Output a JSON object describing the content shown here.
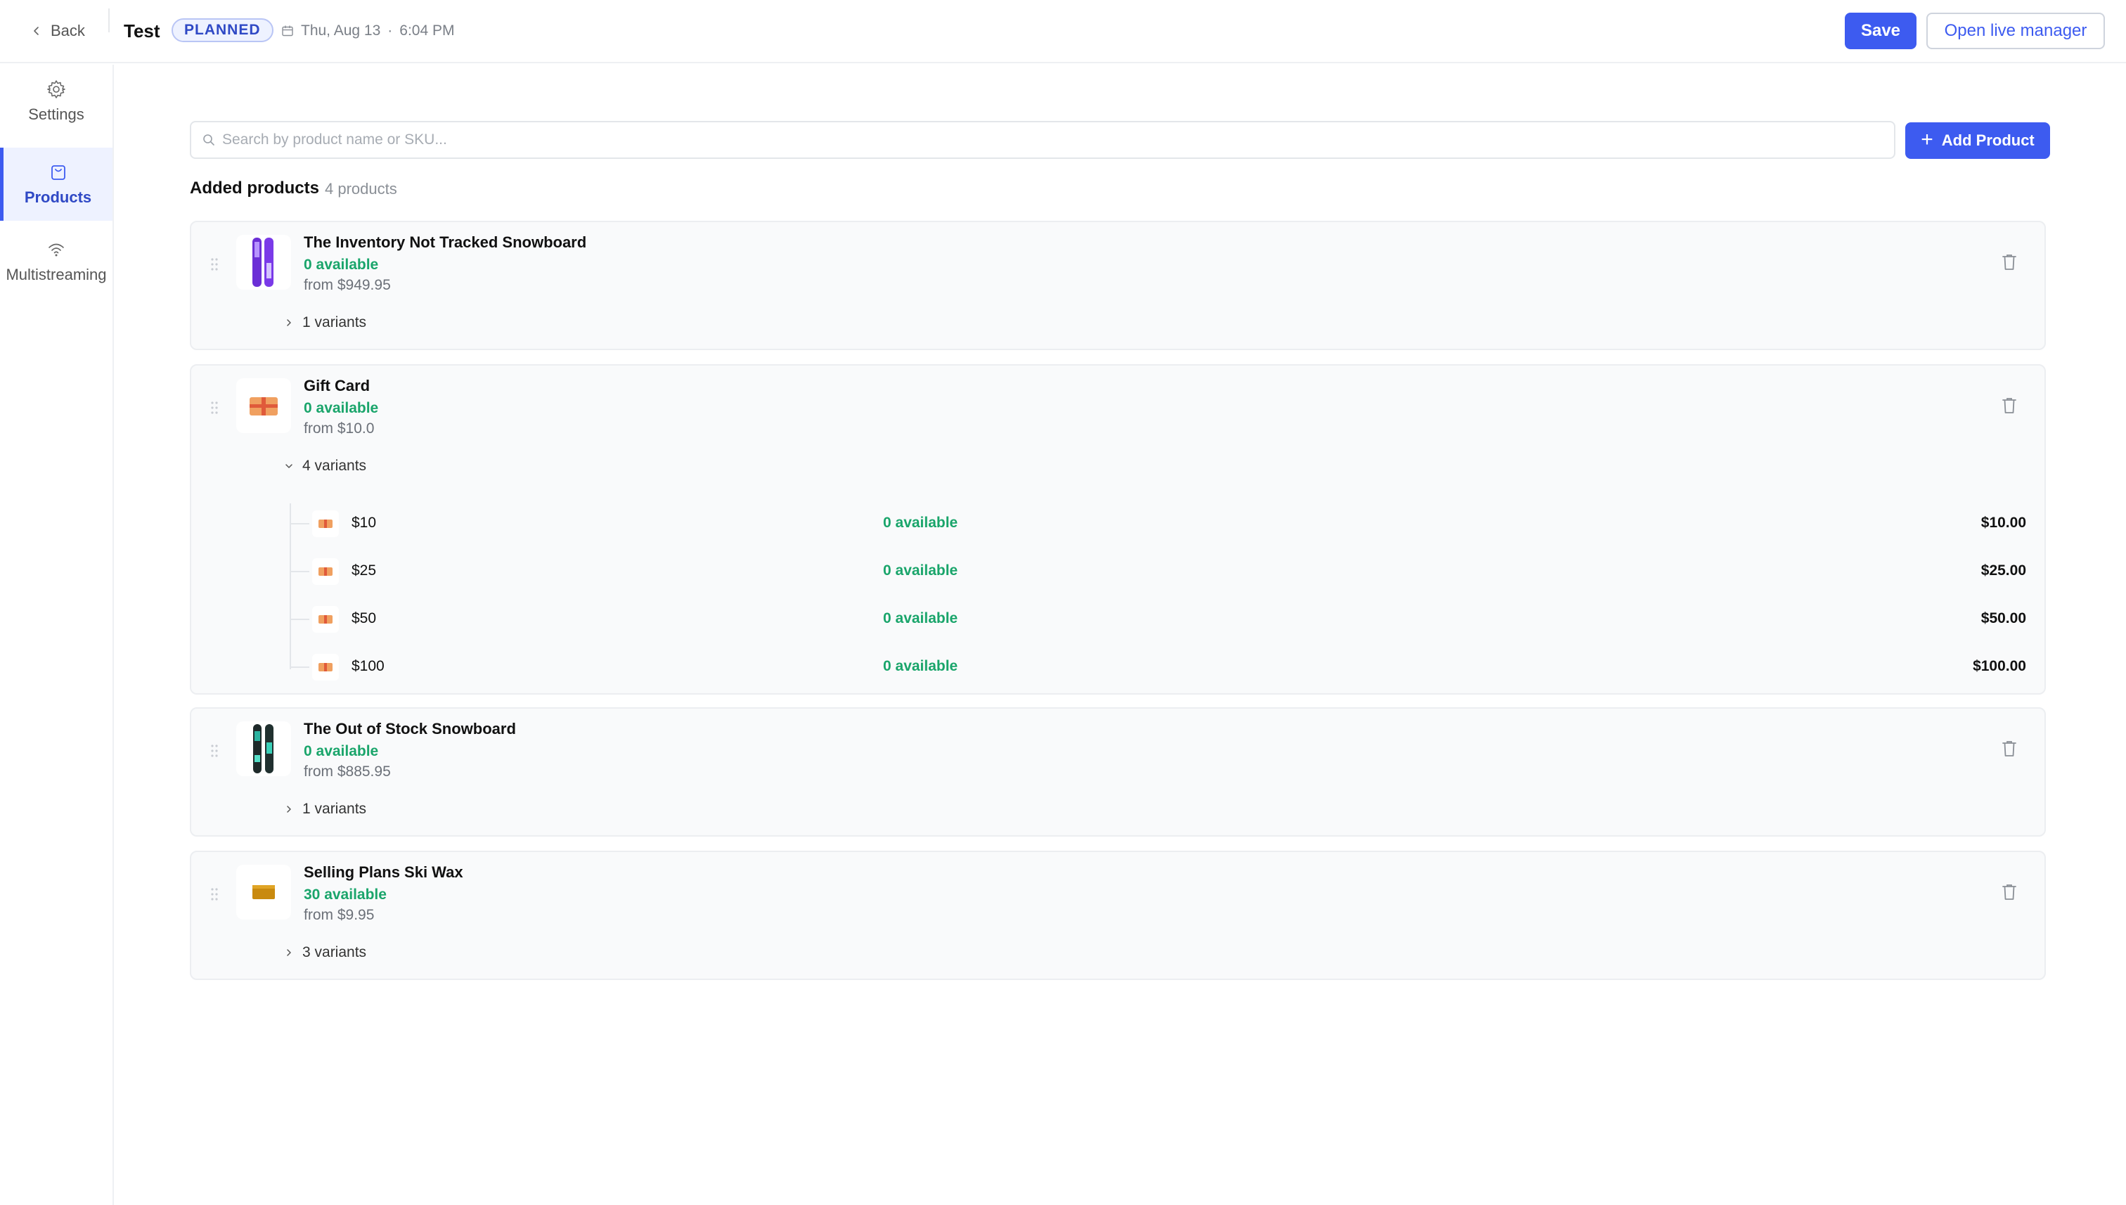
{
  "header": {
    "back_label": "Back",
    "title": "Test",
    "status_badge": "PLANNED",
    "date": "Thu, Aug 13",
    "separator": "·",
    "time": "6:04 PM",
    "save_label": "Save",
    "live_manager_label": "Open live manager"
  },
  "sidebar": {
    "items": [
      {
        "label": "Settings",
        "icon": "gear-icon",
        "active": false
      },
      {
        "label": "Products",
        "icon": "shopping-bag-icon",
        "active": true
      },
      {
        "label": "Multistreaming",
        "icon": "wifi-icon",
        "active": false
      }
    ]
  },
  "search": {
    "placeholder": "Search by product name or SKU..."
  },
  "add_product_label": "Add Product",
  "products_section": {
    "title": "Added products",
    "count": "4 products"
  },
  "products": [
    {
      "name": "The Inventory Not Tracked Snowboard",
      "availability": "0 available",
      "price": "from $949.95",
      "variants_label": "1 variants",
      "expanded": false,
      "image": "purple-snowboard"
    },
    {
      "name": "Gift Card",
      "availability": "0 available",
      "price": "from $10.0",
      "variants_label": "4 variants",
      "expanded": true,
      "image": "gift-card",
      "variants": [
        {
          "name": "$10",
          "availability": "0 available",
          "price": "$10.00"
        },
        {
          "name": "$25",
          "availability": "0 available",
          "price": "$25.00"
        },
        {
          "name": "$50",
          "availability": "0 available",
          "price": "$50.00"
        },
        {
          "name": "$100",
          "availability": "0 available",
          "price": "$100.00"
        }
      ]
    },
    {
      "name": "The Out of Stock Snowboard",
      "availability": "0 available",
      "price": "from $885.95",
      "variants_label": "1 variants",
      "expanded": false,
      "image": "teal-snowboard"
    },
    {
      "name": "Selling Plans Ski Wax",
      "availability": "30 available",
      "price": "from $9.95",
      "variants_label": "3 variants",
      "expanded": false,
      "image": "ski-wax"
    }
  ],
  "colors": {
    "accent": "#3d5bf0",
    "available_green": "#1aa56b",
    "badge_bg": "#eef2ff"
  }
}
